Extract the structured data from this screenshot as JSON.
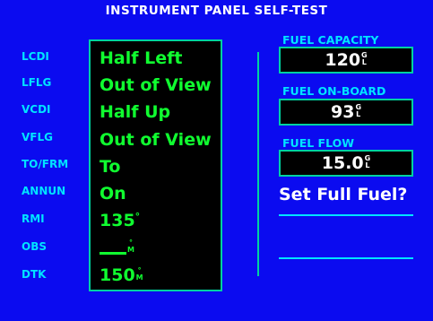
{
  "title": "INSTRUMENT PANEL SELF-TEST",
  "left_labels": [
    "LCDI",
    "LFLG",
    "VCDI",
    "VFLG",
    "TO/FRM",
    "ANNUN",
    "RMI",
    "OBS",
    "DTK"
  ],
  "values": {
    "lcdi": "Half Left",
    "lflg": "Out of View",
    "vcdi": "Half Up",
    "vflg": "Out of View",
    "tofrm": "To",
    "annun": "On",
    "rmi": "135",
    "rmi_unit": "°",
    "obs_unit_top": "°",
    "obs_unit_bottom": "M",
    "dtk": "150",
    "dtk_unit_top": "°",
    "dtk_unit_bottom": "M"
  },
  "fuel": {
    "capacity_label": "FUEL CAPACITY",
    "capacity_value": "120",
    "capacity_unit_top": "G",
    "capacity_unit_bottom": "L",
    "onboard_label": "FUEL ON-BOARD",
    "onboard_value": "93",
    "onboard_unit_top": "G",
    "onboard_unit_bottom": "L",
    "flow_label": "FUEL FLOW",
    "flow_value": "15.0",
    "flow_unit_top": "G",
    "flow_unit_bottom": "L",
    "set_full_label": "Set Full Fuel?"
  },
  "colors": {
    "background": "#0b0bf0",
    "label_cyan": "#00e4ff",
    "value_green": "#10ff30",
    "border": "#00d2a0"
  }
}
